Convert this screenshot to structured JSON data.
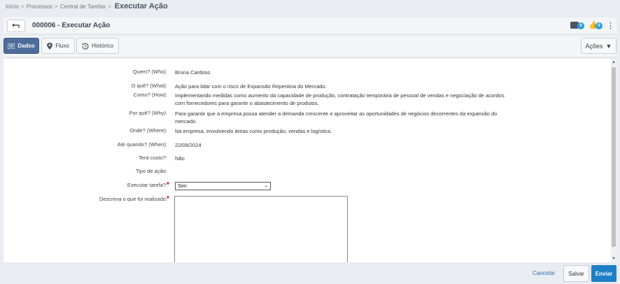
{
  "breadcrumb": {
    "items": [
      "Início",
      "Processos",
      "Central de Tarefas"
    ],
    "separator": ">",
    "current": "Executar Ação"
  },
  "header": {
    "back_icon": "return-arrow-icon",
    "title": "000006 - Executar Ação",
    "comments_count": "0",
    "likes_count": "0",
    "accent_color": "#2d9cdb"
  },
  "tabs": [
    {
      "label": "Dados",
      "icon": "list-icon",
      "active": true
    },
    {
      "label": "Fluxo",
      "icon": "map-pin-icon",
      "active": false
    },
    {
      "label": "Histórico",
      "icon": "history-icon",
      "active": false
    }
  ],
  "actions_menu": {
    "label": "Ações"
  },
  "form": {
    "who": {
      "label": "Quem? (Who):",
      "value": "Bruna Cardoso"
    },
    "what": {
      "label": "O quê? (What):",
      "value": "Ação para lidar com o risco de Expansão Repentina do Mercado."
    },
    "how": {
      "label": "Como? (How):",
      "value": "Implementando medidas como aumento da capacidade de produção, contratação temporária de pessoal de vendas e negociação de acordos com fornecedores para garantir o abastecimento de produtos."
    },
    "why": {
      "label": "Por quê? (Why):",
      "value": "Para garantir que a empresa possa atender a demanda crescente e aproveitar as oportunidades de negócios decorrentes da expansão do mercado."
    },
    "where": {
      "label": "Onde? (Where):",
      "value": "Na empresa, envolvendo áreas como produção, vendas e logística."
    },
    "when": {
      "label": "Até quando? (When):",
      "value": "22/09/2024"
    },
    "cost": {
      "label": "Terá custo?:",
      "value": "Não"
    },
    "action_type": {
      "label": "Tipo de ação:",
      "value": ""
    },
    "execute_task": {
      "label": "Executar tarefa?:",
      "selected": "Sim",
      "required_mark": "*"
    },
    "describe": {
      "label": "Descreva o que foi realizado:",
      "value": "",
      "required_mark": "*"
    }
  },
  "footer": {
    "cancel_label": "Cancelar",
    "save_label": "Salvar",
    "send_label": "Enviar"
  },
  "colors": {
    "active_tab": "#4d6c9b",
    "primary_button": "#1f7fc6",
    "required": "#d0021b",
    "link": "#2f6fad"
  }
}
